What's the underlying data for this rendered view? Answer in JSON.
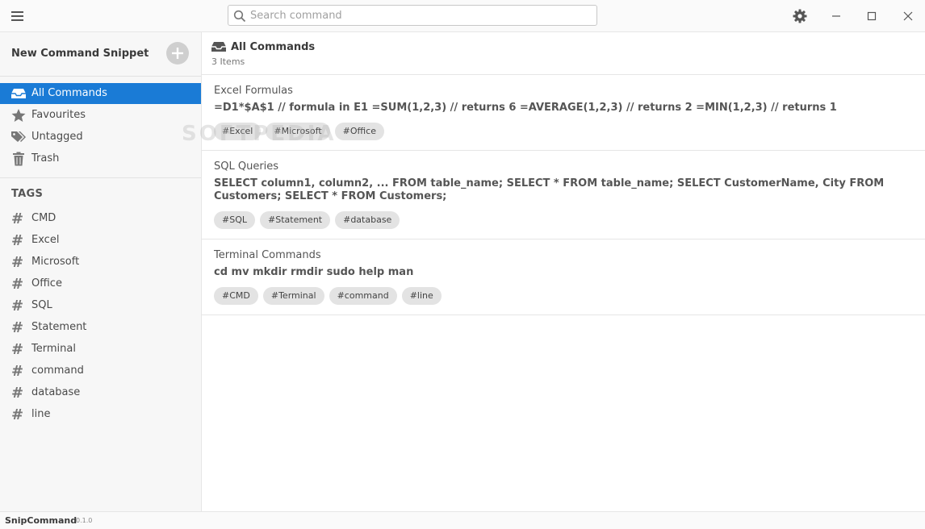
{
  "titlebar": {
    "search": {
      "placeholder": "Search command",
      "value": ""
    }
  },
  "sidebar": {
    "new_snippet_label": "New Command Snippet",
    "nav": [
      {
        "label": "All Commands",
        "icon": "inbox-icon",
        "active": true
      },
      {
        "label": "Favourites",
        "icon": "star-icon",
        "active": false
      },
      {
        "label": "Untagged",
        "icon": "tags-icon",
        "active": false
      },
      {
        "label": "Trash",
        "icon": "trash-icon",
        "active": false
      }
    ],
    "tags_heading": "TAGS",
    "tags": [
      "CMD",
      "Excel",
      "Microsoft",
      "Office",
      "SQL",
      "Statement",
      "Terminal",
      "command",
      "database",
      "line"
    ]
  },
  "main": {
    "header": {
      "title": "All Commands",
      "count": "3 Items"
    },
    "snippets": [
      {
        "title": "Excel Formulas",
        "command": "=D1*$A$1 // formula in E1 =SUM(1,2,3) // returns 6 =AVERAGE(1,2,3) // returns 2 =MIN(1,2,3) // returns 1",
        "tags": [
          "#Excel",
          "#Microsoft",
          "#Office"
        ]
      },
      {
        "title": "SQL Queries",
        "command": "SELECT column1, column2, ... FROM table_name; SELECT * FROM table_name; SELECT CustomerName, City FROM Customers; SELECT * FROM Customers;",
        "tags": [
          "#SQL",
          "#Statement",
          "#database"
        ]
      },
      {
        "title": "Terminal Commands",
        "command": "cd mv mkdir rmdir sudo help man",
        "tags": [
          "#CMD",
          "#Terminal",
          "#command",
          "#line"
        ]
      }
    ]
  },
  "watermark": "SOFTPEDIA",
  "statusbar": {
    "app_name": "SnipCommand",
    "version": "0.1.0"
  },
  "colors": {
    "accent": "#1a7bd6",
    "chip_bg": "#e3e3e3"
  }
}
